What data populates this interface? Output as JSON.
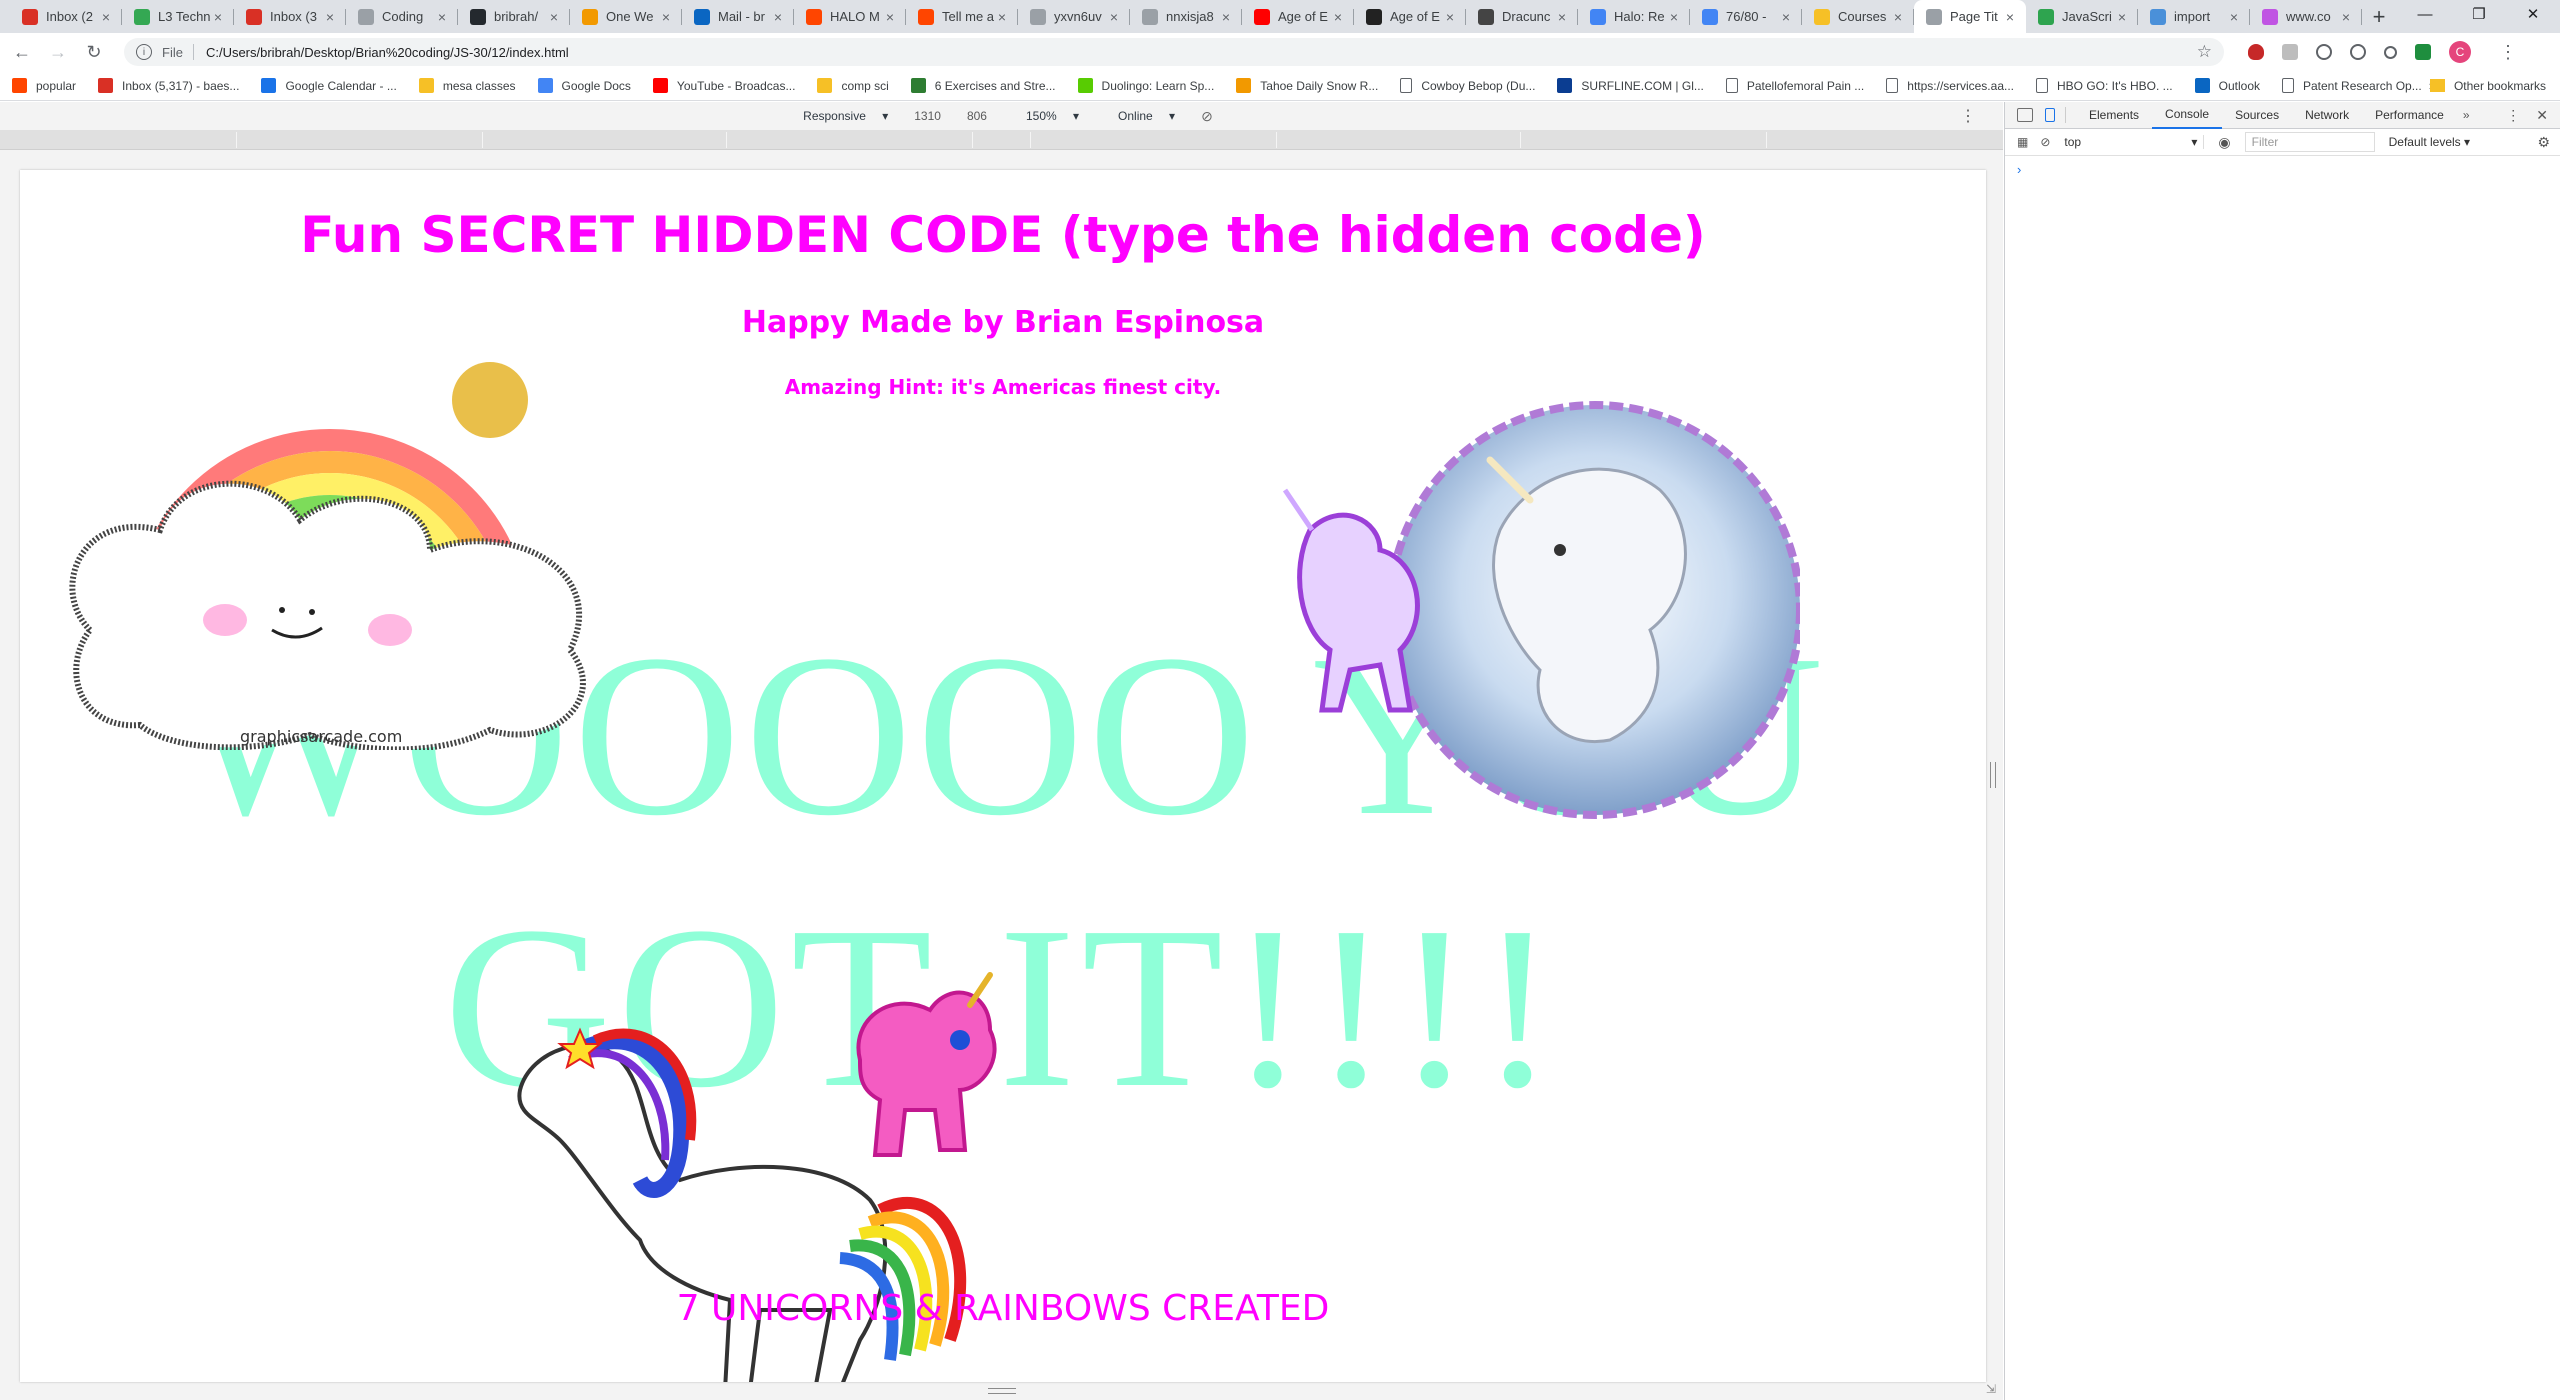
{
  "tabs": [
    {
      "title": "Inbox (2",
      "favicon": "gmail-icon",
      "color": "#d93025"
    },
    {
      "title": "L3 Techn",
      "favicon": "page-icon",
      "color": "#34a853"
    },
    {
      "title": "Inbox (3",
      "favicon": "gmail-icon",
      "color": "#d93025"
    },
    {
      "title": "Coding",
      "favicon": "page-icon",
      "color": "#9aa0a6"
    },
    {
      "title": "bribrah/",
      "favicon": "github-icon",
      "color": "#24292e"
    },
    {
      "title": "One We",
      "favicon": "globe-icon",
      "color": "#f29900"
    },
    {
      "title": "Mail - br",
      "favicon": "outlook-icon",
      "color": "#0a66c2"
    },
    {
      "title": "HALO M",
      "favicon": "reddit-icon",
      "color": "#ff4500"
    },
    {
      "title": "Tell me a",
      "favicon": "reddit-icon",
      "color": "#ff4500"
    },
    {
      "title": "yxvn6uv",
      "favicon": "page-icon",
      "color": "#9aa0a6"
    },
    {
      "title": "nnxisja8",
      "favicon": "page-icon",
      "color": "#9aa0a6"
    },
    {
      "title": "Age of E",
      "favicon": "youtube-icon",
      "color": "#ff0000"
    },
    {
      "title": "Age of E",
      "favicon": "age-icon",
      "color": "#222222"
    },
    {
      "title": "Dracunc",
      "favicon": "wiki-icon",
      "color": "#444444"
    },
    {
      "title": "Halo: Re",
      "favicon": "google-icon",
      "color": "#4285f4"
    },
    {
      "title": "76/80 -",
      "favicon": "google-icon",
      "color": "#4285f4"
    },
    {
      "title": "Courses",
      "favicon": "courses-icon",
      "color": "#f6c026"
    },
    {
      "title": "Page Tit",
      "favicon": "page-icon",
      "color": "#9aa0a6",
      "active": true
    },
    {
      "title": "JavaScri",
      "favicon": "js-icon",
      "color": "#2ea44f"
    },
    {
      "title": "import",
      "favicon": "import-icon",
      "color": "#4a90d9"
    },
    {
      "title": "www.co",
      "favicon": "rainbow-icon",
      "color": "#c054e3"
    }
  ],
  "address": {
    "scheme": "File",
    "url": "C:/Users/bribrah/Desktop/Brian%20coding/JS-30/12/index.html"
  },
  "profile_initial": "C",
  "bookmarks": [
    {
      "label": "popular",
      "icon": "reddit-icon",
      "color": "#ff4500"
    },
    {
      "label": "Inbox (5,317) - baes...",
      "icon": "gmail-icon",
      "color": "#d93025"
    },
    {
      "label": "Google Calendar - ...",
      "icon": "calendar-icon",
      "color": "#1a73e8"
    },
    {
      "label": "mesa classes",
      "icon": "folder-icon",
      "color": "#f6c026"
    },
    {
      "label": "Google Docs",
      "icon": "docs-icon",
      "color": "#4285f4"
    },
    {
      "label": "YouTube - Broadcas...",
      "icon": "youtube-icon",
      "color": "#ff0000"
    },
    {
      "label": "comp sci",
      "icon": "folder-icon",
      "color": "#f6c026"
    },
    {
      "label": "6 Exercises and Stre...",
      "icon": "exercise-icon",
      "color": "#2e7d32"
    },
    {
      "label": "Duolingo: Learn Sp...",
      "icon": "duolingo-icon",
      "color": "#58cc02"
    },
    {
      "label": "Tahoe Daily Snow R...",
      "icon": "snow-icon",
      "color": "#f29900"
    },
    {
      "label": "Cowboy Bebop (Du...",
      "icon": "page-icon",
      "color": "#9aa0a6"
    },
    {
      "label": "SURFLINE.COM | Gl...",
      "icon": "surfline-icon",
      "color": "#0b3d91"
    },
    {
      "label": "Patellofemoral Pain ...",
      "icon": "page-icon",
      "color": "#9aa0a6"
    },
    {
      "label": "https://services.aa...",
      "icon": "page-icon",
      "color": "#9aa0a6"
    },
    {
      "label": "HBO GO: It's HBO. ...",
      "icon": "page-icon",
      "color": "#9aa0a6"
    },
    {
      "label": "Outlook",
      "icon": "outlook-icon",
      "color": "#0a66c2"
    },
    {
      "label": "Patent Research Op...",
      "icon": "page-icon",
      "color": "#9aa0a6"
    }
  ],
  "bookmarks_more": "»",
  "other_bookmarks": "Other bookmarks",
  "device_toolbar": {
    "mode": "Responsive",
    "width": "1310",
    "height": "806",
    "zoom": "150%",
    "network": "Online"
  },
  "page": {
    "title": "Fun SECRET HIDDEN CODE (type the hidden code)",
    "subtitle": "Happy Made by Brian Espinosa",
    "hint": "Amazing Hint: it's Americas finest city.",
    "big_line1": "WOOOOO YOU",
    "big_line2": "GOT IT!!!!",
    "footer": "7 UNICORNS & RAINBOWS CREATED",
    "watermark": "graphicsarcade.com"
  },
  "devtools": {
    "tabs": [
      "Elements",
      "Console",
      "Sources",
      "Network",
      "Performance"
    ],
    "active_tab": "Console",
    "context": "top",
    "filter_placeholder": "Filter",
    "levels": "Default levels",
    "prompt": "›"
  }
}
